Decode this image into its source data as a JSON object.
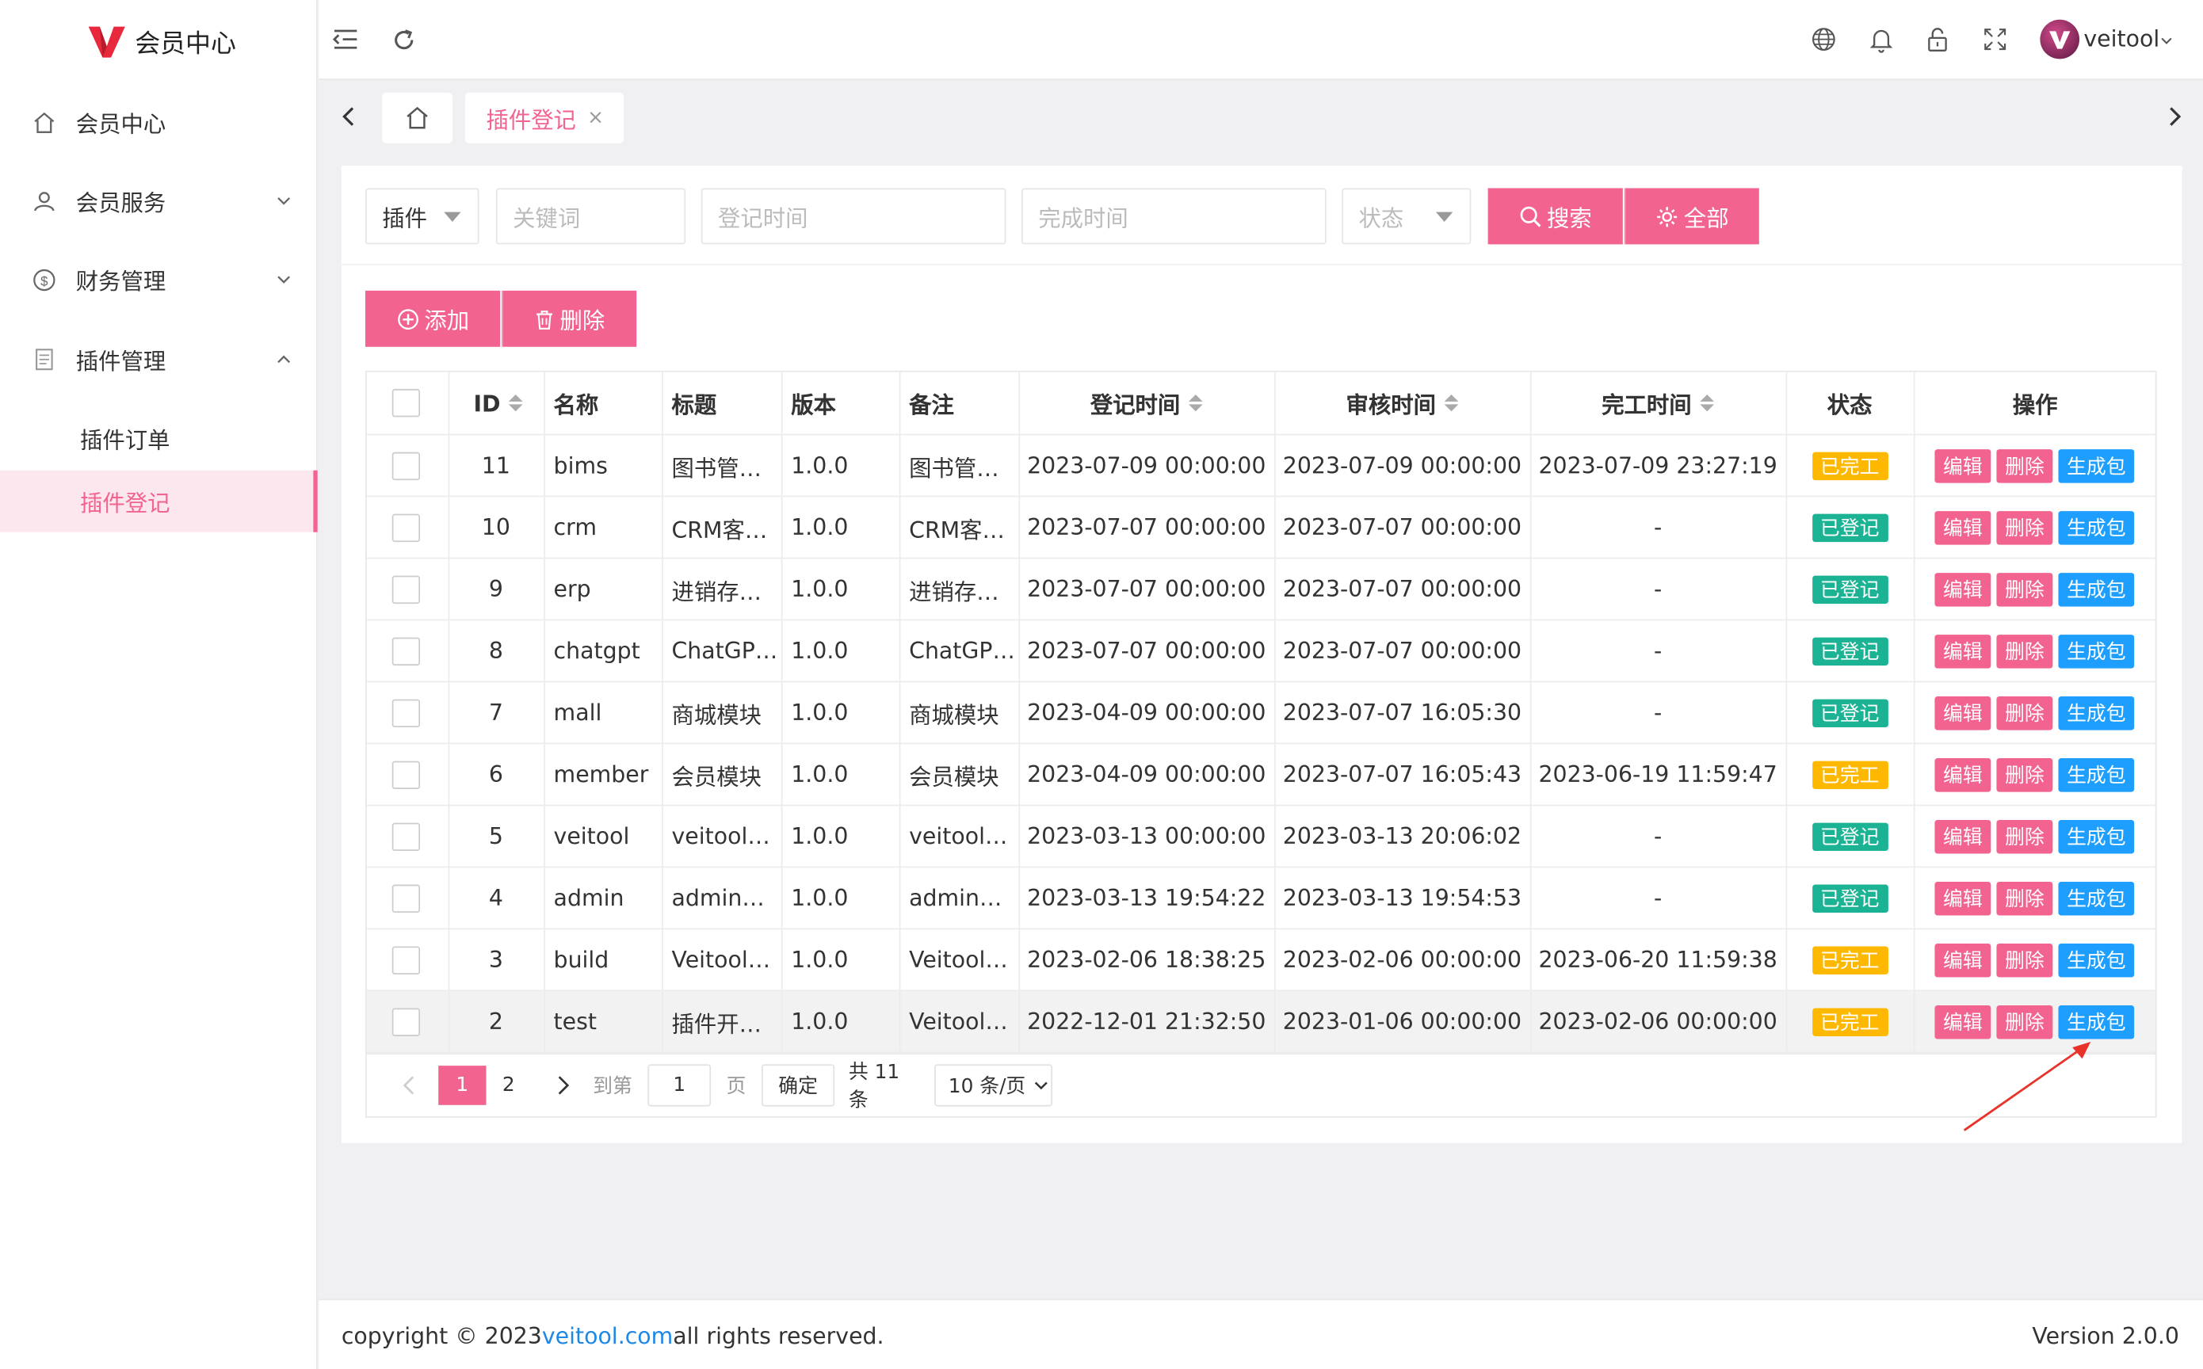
{
  "app": {
    "title": "会员中心",
    "user": "veitool"
  },
  "sidebar": {
    "items": [
      {
        "label": "会员中心",
        "icon": "home-icon"
      },
      {
        "label": "会员服务",
        "icon": "user-icon"
      },
      {
        "label": "财务管理",
        "icon": "dollar-icon"
      },
      {
        "label": "插件管理",
        "icon": "document-icon"
      }
    ],
    "sub": [
      {
        "label": "插件订单"
      },
      {
        "label": "插件登记",
        "active": true
      }
    ]
  },
  "tabs": {
    "active_label": "插件登记",
    "close": "×"
  },
  "search": {
    "type_value": "插件",
    "keyword_placeholder": "关键词",
    "reg_time_placeholder": "登记时间",
    "done_time_placeholder": "完成时间",
    "status_placeholder": "状态",
    "search_label": "搜索",
    "all_label": "全部"
  },
  "toolbar": {
    "add_label": "添加",
    "delete_label": "删除"
  },
  "table": {
    "headers": [
      "ID",
      "名称",
      "标题",
      "版本",
      "备注",
      "登记时间",
      "审核时间",
      "完工时间",
      "状态",
      "操作"
    ],
    "actions": {
      "edit": "编辑",
      "delete": "删除",
      "build": "生成包"
    },
    "rows": [
      {
        "id": "11",
        "name": "bims",
        "title": "图书管…",
        "version": "1.0.0",
        "note": "图书管…",
        "reg": "2023-07-09 00:00:00",
        "audit": "2023-07-09 00:00:00",
        "done": "2023-07-09 23:27:19",
        "status": "已完工",
        "status_type": "done"
      },
      {
        "id": "10",
        "name": "crm",
        "title": "CRM客…",
        "version": "1.0.0",
        "note": "CRM客…",
        "reg": "2023-07-07 00:00:00",
        "audit": "2023-07-07 00:00:00",
        "done": "-",
        "status": "已登记",
        "status_type": "reg"
      },
      {
        "id": "9",
        "name": "erp",
        "title": "进销存…",
        "version": "1.0.0",
        "note": "进销存…",
        "reg": "2023-07-07 00:00:00",
        "audit": "2023-07-07 00:00:00",
        "done": "-",
        "status": "已登记",
        "status_type": "reg"
      },
      {
        "id": "8",
        "name": "chatgpt",
        "title": "ChatGP…",
        "version": "1.0.0",
        "note": "ChatGP…",
        "reg": "2023-07-07 00:00:00",
        "audit": "2023-07-07 00:00:00",
        "done": "-",
        "status": "已登记",
        "status_type": "reg"
      },
      {
        "id": "7",
        "name": "mall",
        "title": "商城模块",
        "version": "1.0.0",
        "note": "商城模块",
        "reg": "2023-04-09 00:00:00",
        "audit": "2023-07-07 16:05:30",
        "done": "-",
        "status": "已登记",
        "status_type": "reg"
      },
      {
        "id": "6",
        "name": "member",
        "title": "会员模块",
        "version": "1.0.0",
        "note": "会员模块",
        "reg": "2023-04-09 00:00:00",
        "audit": "2023-07-07 16:05:43",
        "done": "2023-06-19 11:59:47",
        "status": "已完工",
        "status_type": "done"
      },
      {
        "id": "5",
        "name": "veitool",
        "title": "veitool…",
        "version": "1.0.0",
        "note": "veitool…",
        "reg": "2023-03-13 00:00:00",
        "audit": "2023-03-13 20:06:02",
        "done": "-",
        "status": "已登记",
        "status_type": "reg"
      },
      {
        "id": "4",
        "name": "admin",
        "title": "admin…",
        "version": "1.0.0",
        "note": "admin…",
        "reg": "2023-03-13 19:54:22",
        "audit": "2023-03-13 19:54:53",
        "done": "-",
        "status": "已登记",
        "status_type": "reg"
      },
      {
        "id": "3",
        "name": "build",
        "title": "Veitool…",
        "version": "1.0.0",
        "note": "Veitool…",
        "reg": "2023-02-06 18:38:25",
        "audit": "2023-02-06 00:00:00",
        "done": "2023-06-20 11:59:38",
        "status": "已完工",
        "status_type": "done"
      },
      {
        "id": "2",
        "name": "test",
        "title": "插件开…",
        "version": "1.0.0",
        "note": "Veitool…",
        "reg": "2022-12-01 21:32:50",
        "audit": "2023-01-06 00:00:00",
        "done": "2023-02-06 00:00:00",
        "status": "已完工",
        "status_type": "done"
      }
    ]
  },
  "pagination": {
    "pages": [
      "1",
      "2"
    ],
    "goto_label": "到第",
    "page_input": "1",
    "page_unit": "页",
    "confirm": "确定",
    "total": "共 11 条",
    "per_page": "10 条/页"
  },
  "footer": {
    "copyright_prefix": "copyright © 2023",
    "link": "veitool.com",
    "copyright_suffix": "all rights reserved.",
    "version": "Version 2.0.0"
  },
  "colors": {
    "accent": "#f2648f",
    "blue": "#1e9fff",
    "done": "#ffb800",
    "registered": "#1bb394",
    "annotation_arrow": "#e8322a"
  }
}
